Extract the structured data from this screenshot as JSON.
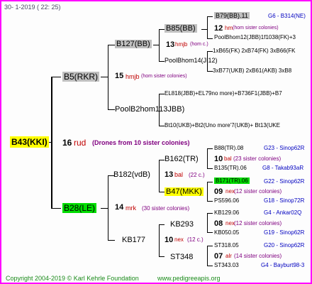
{
  "header": {
    "text": "30-   1-2019  (  22:  25)"
  },
  "footer": {
    "copyright": "Copyright 2004-2019 © Karl Kehrle Foundation",
    "url": "www.pedigreeapis.org"
  },
  "root": {
    "name": "B43(KKI)",
    "year": "16",
    "breeder": "rud",
    "drones": "(Drones from 10 sister colonies)"
  },
  "mother": {
    "name": "B5(RKR)",
    "year": "15",
    "breeder": "hmjb",
    "note": "(hom sister colonies)"
  },
  "father": {
    "name": "B28(LE)",
    "year": "14",
    "breeder": "mrk",
    "note": "(30 sister colonies)"
  },
  "mm": {
    "name": "B127(BB)"
  },
  "mmm": {
    "name": "B85(BB)"
  },
  "mmmm": {
    "name": "B79(BB).11",
    "loc": "G6 - B314(NE)"
  },
  "mmm_line": {
    "year": "12",
    "breeder": "hm",
    "note": "(hom sister colonies)"
  },
  "mmmf": {
    "name": "PoolBhom12(JBB)1f1038(FK)+3"
  },
  "mmf": {
    "name": "PoolBhom14(JI12)"
  },
  "mmf_line1": {
    "text": "1xB65(FK) 2xB74(FK) 3xB66(FK"
  },
  "mm_line": {
    "year": "13",
    "breeder": "hmjb",
    "note": "(hom c.)"
  },
  "mmf_line2": {
    "text": "3xB77(UKB) 2xB61(AKB) 3xB8"
  },
  "mf": {
    "name": "PoolB2hom113JBB)"
  },
  "mf_line1": {
    "text": "EL818(JBB)+EL79no more)+B736F1(JBB)+B7"
  },
  "mf_line2": {
    "text": "Bt10(UKB)+Bt2(Uno more'7(UKB)+ Bt13(UKE"
  },
  "fm": {
    "name": "B182(vdB)"
  },
  "fm_line": {
    "year": "13",
    "breeder": "bal",
    "note": "(22 c.)"
  },
  "fmm": {
    "name": "B162(TR)"
  },
  "fmm_line": {
    "year": "10",
    "breeder": "bal",
    "note": "(23 sister colonies)"
  },
  "fmmm": {
    "name": "B88(TR).08",
    "loc": "G23 - Sinop62R"
  },
  "fmmf": {
    "name": "B135(TR).06",
    "loc": "G8 - Takab93aR"
  },
  "fmf": {
    "name": "B47(MKK)"
  },
  "fmfm": {
    "name": "B171(TR).06",
    "loc": "G22 - Sinop62R"
  },
  "fmf_line": {
    "year": "09",
    "breeder": "nex",
    "note": "(12 sister colonies)"
  },
  "fmff": {
    "name": "PS596.06",
    "loc": "G18 - Sinop72R"
  },
  "ff": {
    "name": "KB177"
  },
  "ff_line": {
    "year": "10",
    "breeder": "nex",
    "note": "(12 c.)"
  },
  "ffm": {
    "name": "KB293"
  },
  "ffmm": {
    "name": "KB129.06",
    "loc": "G4 - Ankar02Q"
  },
  "ffm_line": {
    "year": "08",
    "breeder": "nex",
    "note": "(12 sister colonies)"
  },
  "ffmf": {
    "name": "KB050.05",
    "loc": "G19 - Sinop62R"
  },
  "fff": {
    "name": "ST348"
  },
  "fffm": {
    "name": "ST318.05",
    "loc": "G20 - Sinop62R"
  },
  "fff_line": {
    "year": "07",
    "breeder": "alr",
    "note": "(14 sister colonies)"
  },
  "ffff": {
    "name": "ST343.03",
    "loc": "G4 - Bayburt98-3"
  }
}
